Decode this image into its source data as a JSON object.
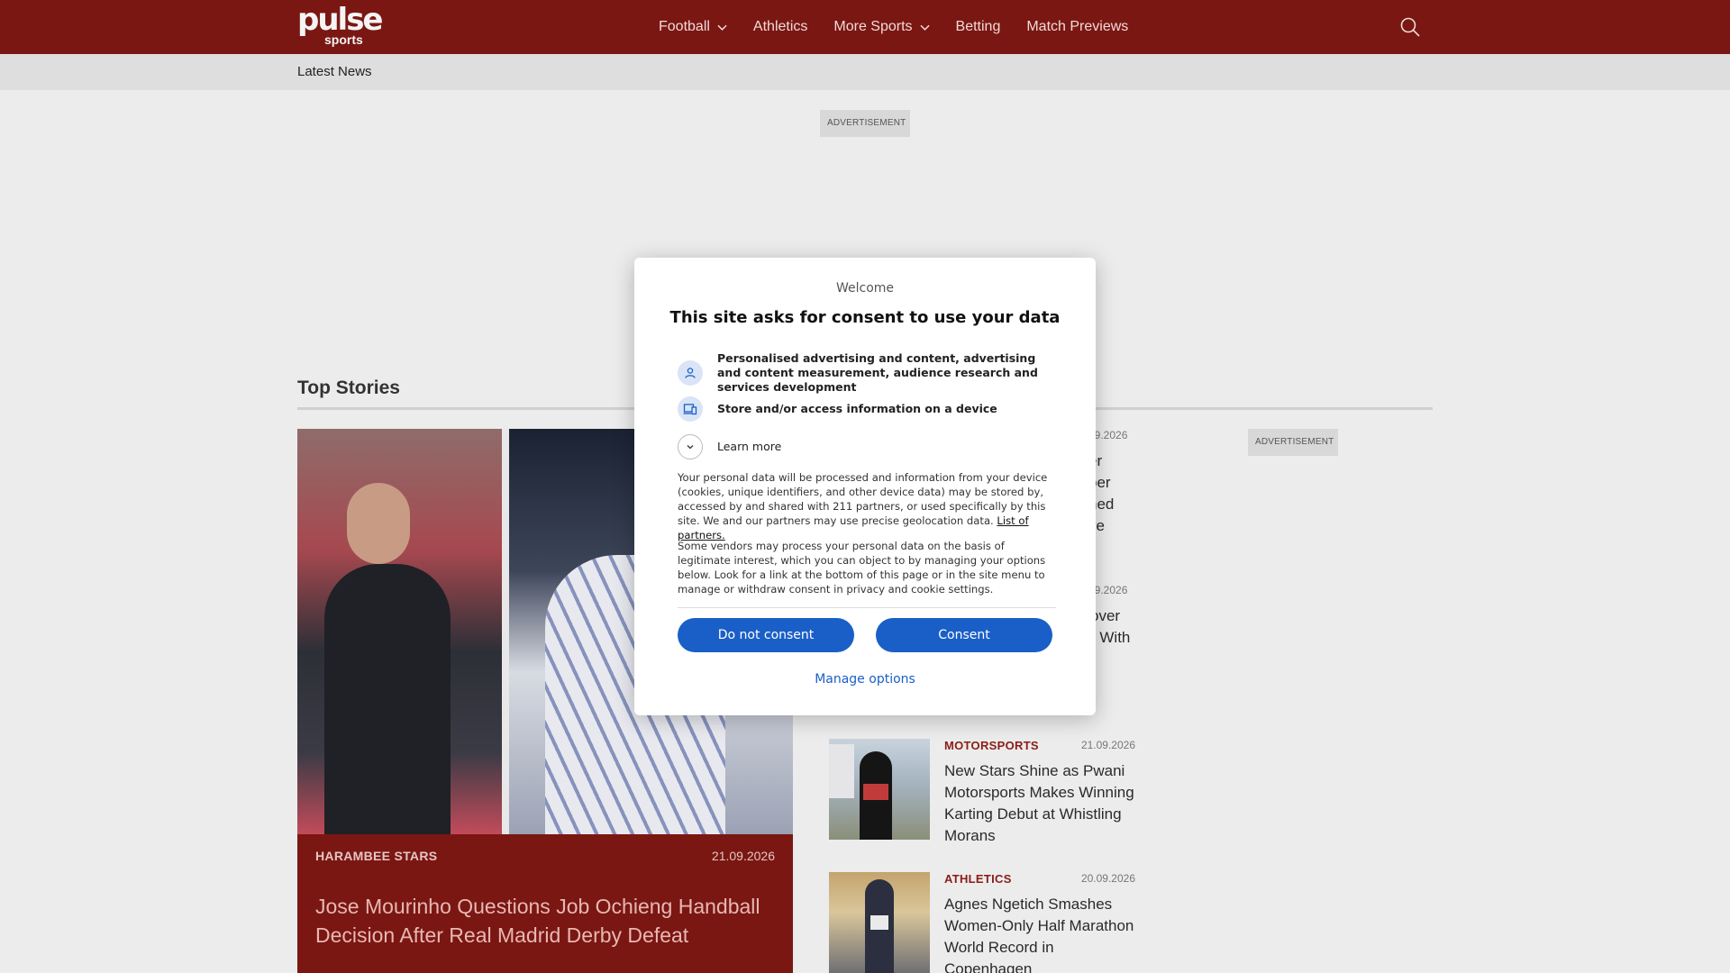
{
  "header": {
    "logo_main": "pulse",
    "logo_sub": "sports",
    "nav": [
      {
        "label": "Football",
        "has_dropdown": true
      },
      {
        "label": "Athletics",
        "has_dropdown": false
      },
      {
        "label": "More Sports",
        "has_dropdown": true
      },
      {
        "label": "Betting",
        "has_dropdown": false
      },
      {
        "label": "Match Previews",
        "has_dropdown": false
      }
    ],
    "search_icon": "search-icon"
  },
  "subbar": {
    "latest_label": "Latest News"
  },
  "ads": {
    "label": "ADVERTISEMENT"
  },
  "top_stories": {
    "title": "Top Stories",
    "main": {
      "category": "HARAMBEE STARS",
      "date": "21.09.2026",
      "headline": "Jose Mourinho Questions Job Ochieng Handball Decision After Real Madrid Derby Defeat"
    },
    "side": [
      {
        "category": "MOTORSPORTS",
        "date": "21.09.2026",
        "headline": "New Stars Shine as Pwani Motorsports Makes Winning Karting Debut at Whistling Morans"
      },
      {
        "category": "ATHLETICS",
        "date": "20.09.2026",
        "headline": "Agnes Ngetich Smashes Women-Only Half Marathon World Record in Copenhagen"
      }
    ],
    "partial": {
      "date_1": "09.2026",
      "lines_1": [
        "er",
        "per",
        "ned",
        "ve"
      ],
      "date_2": "09.2026",
      "lines_2": [
        "over",
        "r With"
      ]
    }
  },
  "consent": {
    "welcome": "Welcome",
    "title": "This site asks for consent to use your data",
    "purposes": [
      {
        "icon": "person-icon",
        "text": "Personalised advertising and content, advertising and content measurement, audience research and services development"
      },
      {
        "icon": "device-icon",
        "text": "Store and/or access information on a device"
      }
    ],
    "learn_more": "Learn more",
    "para1": "Your personal data will be processed and information from your device (cookies, unique identifiers, and other device data) may be stored by, accessed by and shared with 211 partners, or used specifically by this site. We and our partners may use precise geolocation data.",
    "partners_link": "List of partners.",
    "para2": "Some vendors may process your personal data on the basis of legitimate interest, which you can object to by managing your options below. Look for a link at the bottom of this page or in the site menu to manage or withdraw consent in privacy and cookie settings.",
    "do_not_consent": "Do not consent",
    "consent": "Consent",
    "manage": "Manage options",
    "accent": "#1a5fc7"
  },
  "colors": {
    "brand": "#7a1712",
    "category": "#8a1d17"
  }
}
